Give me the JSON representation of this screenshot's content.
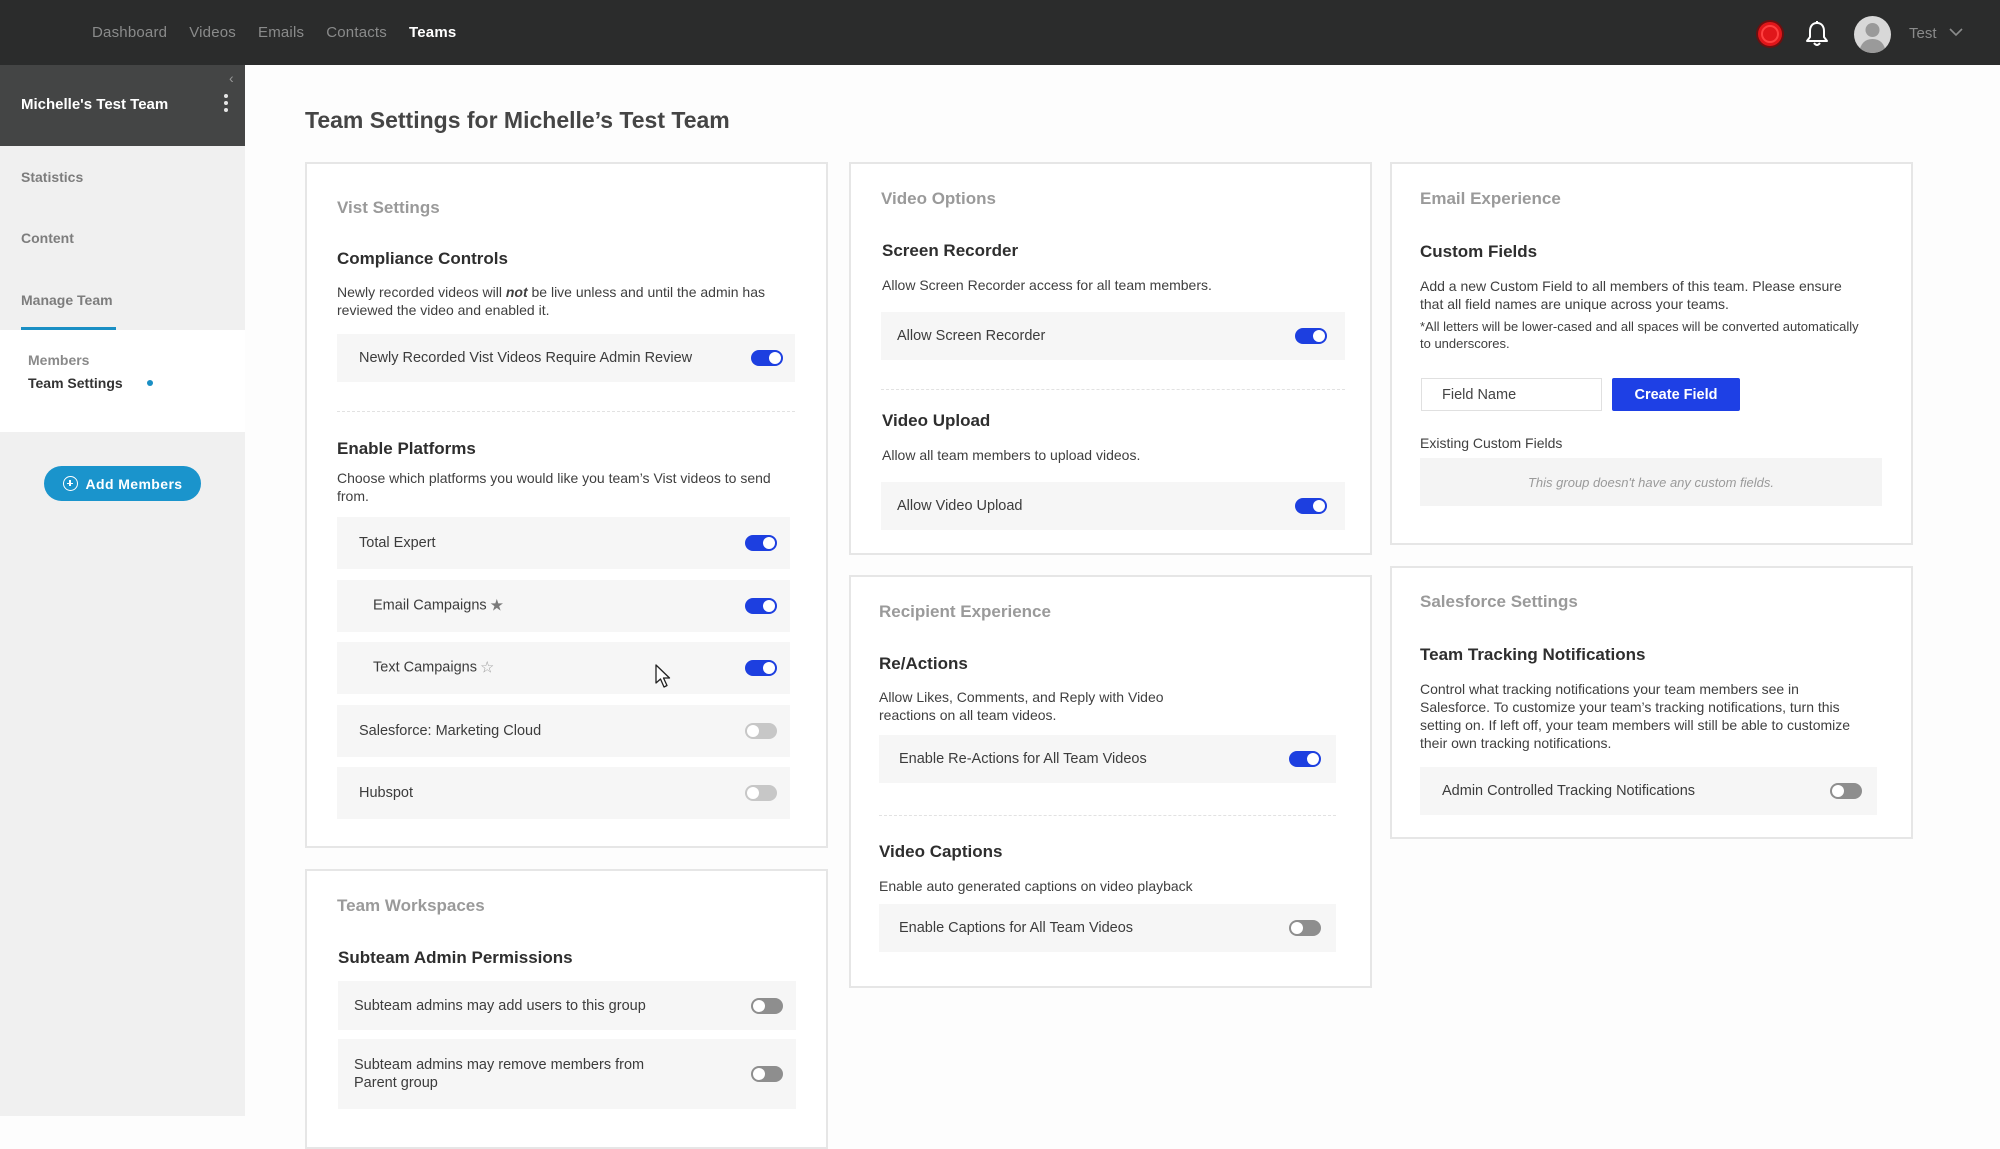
{
  "nav": {
    "items": [
      {
        "label": "Dashboard",
        "active": false
      },
      {
        "label": "Videos",
        "active": false
      },
      {
        "label": "Emails",
        "active": false
      },
      {
        "label": "Contacts",
        "active": false
      },
      {
        "label": "Teams",
        "active": true
      }
    ],
    "user_name": "Test",
    "icons": [
      "record-icon",
      "bell-icon",
      "avatar",
      "chevron-down-icon"
    ],
    "record_color": "#e0161a"
  },
  "sidebar": {
    "team_name": "Michelle's Test Team",
    "items": [
      {
        "label": "Statistics"
      },
      {
        "label": "Content"
      },
      {
        "label": "Manage Team",
        "active": true
      }
    ],
    "subitems": [
      {
        "label": "Members",
        "active": false
      },
      {
        "label": "Team Settings",
        "active": true
      }
    ],
    "add_members_label": "Add Members",
    "accent_color": "#1a94cc"
  },
  "page": {
    "title": "Team Settings for Michelle’s Test Team"
  },
  "vist_settings": {
    "card_title": "Vist Settings",
    "compliance": {
      "title": "Compliance Controls",
      "desc_before": "Newly recorded videos will ",
      "desc_em": "not",
      "desc_after": " be live unless and until the admin has reviewed the video and enabled it.",
      "toggle_label": "Newly Recorded Vist Videos Require Admin Review",
      "toggle_on": true
    },
    "platforms": {
      "title": "Enable Platforms",
      "desc": "Choose which platforms you would like you team’s Vist videos to send from.",
      "items": [
        {
          "label": "Total Expert",
          "on": true
        },
        {
          "label": "Email Campaigns",
          "on": true,
          "star": "filled"
        },
        {
          "label": "Text Campaigns",
          "on": true,
          "star": "empty"
        },
        {
          "label": "Salesforce: Marketing Cloud",
          "on": false
        },
        {
          "label": "Hubspot",
          "on": false
        }
      ]
    }
  },
  "team_workspaces": {
    "card_title": "Team Workspaces",
    "section_title": "Subteam Admin Permissions",
    "items": [
      {
        "label": "Subteam admins may add users to this group",
        "on": false
      },
      {
        "label": "Subteam admins may remove members from Parent group",
        "on": false
      }
    ]
  },
  "video_options": {
    "card_title": "Video Options",
    "screen_recorder": {
      "title": "Screen Recorder",
      "desc": "Allow Screen Recorder access for all team members.",
      "toggle_label": "Allow Screen Recorder",
      "on": true
    },
    "video_upload": {
      "title": "Video Upload",
      "desc": "Allow all team members to upload videos.",
      "toggle_label": "Allow Video Upload",
      "on": true
    }
  },
  "recipient_experience": {
    "card_title": "Recipient Experience",
    "reactions": {
      "title": "Re/Actions",
      "desc": "Allow Likes, Comments, and Reply with Video reactions on all team videos.",
      "toggle_label": "Enable Re-Actions for All Team Videos",
      "on": true
    },
    "captions": {
      "title": "Video Captions",
      "desc": "Enable auto generated captions on video playback",
      "toggle_label": "Enable Captions for All Team Videos",
      "on": false
    }
  },
  "email_experience": {
    "card_title": "Email Experience",
    "section_title": "Custom Fields",
    "desc": "Add a new Custom Field to all members of this team. Please ensure that all field names are unique across your teams.",
    "note": "*All letters will be lower-cased and all spaces will be converted automatically to underscores.",
    "field_placeholder": "Field Name",
    "field_value": "",
    "create_button": "Create Field",
    "existing_label": "Existing Custom Fields",
    "empty_text": "This group doesn't have any custom fields.",
    "button_color": "#1e40e5"
  },
  "salesforce_settings": {
    "card_title": "Salesforce Settings",
    "section_title": "Team Tracking Notifications",
    "desc": "Control what tracking notifications your team members see in Salesforce. To customize your team’s tracking notifications, turn this setting on. If left off, your team members will still be able to customize their own tracking notifications.",
    "toggle_label": "Admin Controlled Tracking Notifications",
    "on": false
  },
  "colors": {
    "toggle_on": "#1d3fe0",
    "toggle_off": "#c7c7c7",
    "topbar": "#2b2c2c"
  }
}
